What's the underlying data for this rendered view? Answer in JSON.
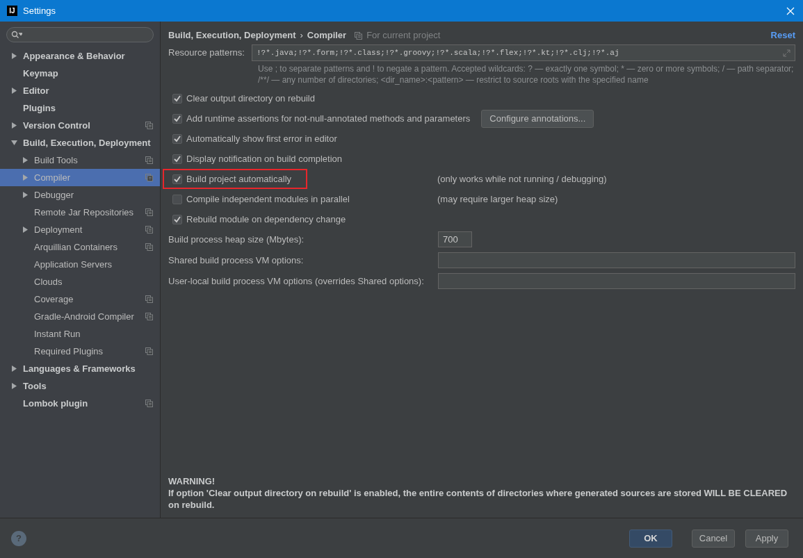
{
  "window": {
    "title": "Settings",
    "app_icon": "IJ"
  },
  "sidebar": {
    "items": [
      {
        "label": "Appearance & Behavior",
        "expanded": false,
        "has_children": true,
        "project_scope": false,
        "selected": false
      },
      {
        "label": "Keymap",
        "has_children": false,
        "project_scope": false,
        "selected": false
      },
      {
        "label": "Editor",
        "expanded": false,
        "has_children": true,
        "project_scope": false,
        "selected": false
      },
      {
        "label": "Plugins",
        "has_children": false,
        "project_scope": false,
        "selected": false
      },
      {
        "label": "Version Control",
        "expanded": false,
        "has_children": true,
        "project_scope": true,
        "selected": false
      },
      {
        "label": "Build, Execution, Deployment",
        "expanded": true,
        "has_children": true,
        "project_scope": false,
        "selected": false,
        "children": [
          {
            "label": "Build Tools",
            "expanded": false,
            "has_children": true,
            "project_scope": true,
            "selected": false
          },
          {
            "label": "Compiler",
            "expanded": false,
            "has_children": true,
            "project_scope": true,
            "selected": true
          },
          {
            "label": "Debugger",
            "expanded": false,
            "has_children": true,
            "project_scope": false,
            "selected": false
          },
          {
            "label": "Remote Jar Repositories",
            "has_children": false,
            "project_scope": true,
            "selected": false
          },
          {
            "label": "Deployment",
            "expanded": false,
            "has_children": true,
            "project_scope": true,
            "selected": false
          },
          {
            "label": "Arquillian Containers",
            "has_children": false,
            "project_scope": true,
            "selected": false
          },
          {
            "label": "Application Servers",
            "has_children": false,
            "project_scope": false,
            "selected": false
          },
          {
            "label": "Clouds",
            "has_children": false,
            "project_scope": false,
            "selected": false
          },
          {
            "label": "Coverage",
            "has_children": false,
            "project_scope": true,
            "selected": false
          },
          {
            "label": "Gradle-Android Compiler",
            "has_children": false,
            "project_scope": true,
            "selected": false
          },
          {
            "label": "Instant Run",
            "has_children": false,
            "project_scope": false,
            "selected": false
          },
          {
            "label": "Required Plugins",
            "has_children": false,
            "project_scope": true,
            "selected": false
          }
        ]
      },
      {
        "label": "Languages & Frameworks",
        "expanded": false,
        "has_children": true,
        "project_scope": false,
        "selected": false
      },
      {
        "label": "Tools",
        "expanded": false,
        "has_children": true,
        "project_scope": false,
        "selected": false
      },
      {
        "label": "Lombok plugin",
        "has_children": false,
        "project_scope": true,
        "selected": false
      }
    ]
  },
  "breadcrumb": {
    "parent": "Build, Execution, Deployment",
    "separator": "›",
    "current": "Compiler",
    "scope": "For current project"
  },
  "reset_link": "Reset",
  "resource_patterns": {
    "label": "Resource patterns:",
    "value": "!?*.java;!?*.form;!?*.class;!?*.groovy;!?*.scala;!?*.flex;!?*.kt;!?*.clj;!?*.aj",
    "hint": [
      "Use ; to separate patterns and ! to negate a pattern. Accepted wildcards: ? — exactly one symbol; * — zero or more symbols; / — path separator;",
      "/**/ — any number of directories;  <dir_name>:<pattern> — restrict to source roots with the specified name"
    ]
  },
  "options": [
    {
      "label": "Clear output directory on rebuild",
      "checked": true,
      "highlighted": false
    },
    {
      "label": "Add runtime assertions for not-null-annotated methods and parameters",
      "checked": true,
      "highlighted": false,
      "button": "Configure annotations..."
    },
    {
      "label": "Automatically show first error in editor",
      "checked": true,
      "highlighted": false
    },
    {
      "label": "Display notification on build completion",
      "checked": true,
      "highlighted": false
    },
    {
      "label": "Build project automatically",
      "checked": true,
      "highlighted": true,
      "note": "(only works while not running / debugging)"
    },
    {
      "label": "Compile independent modules in parallel",
      "checked": false,
      "highlighted": false,
      "note": "(may require larger heap size)"
    },
    {
      "label": "Rebuild module on dependency change",
      "checked": true,
      "highlighted": false
    }
  ],
  "fields": [
    {
      "label": "Build process heap size (Mbytes):",
      "value": "700",
      "kind": "short"
    },
    {
      "label": "Shared build process VM options:",
      "kind": "wide"
    },
    {
      "label": "User-local build process VM options (overrides Shared options):",
      "kind": "wide"
    }
  ],
  "warning": {
    "title": "WARNING!",
    "text": "If option 'Clear output directory on rebuild' is enabled, the entire contents of directories where generated sources are stored WILL BE CLEARED on rebuild."
  },
  "buttons": [
    {
      "label": "OK",
      "primary": true
    },
    {
      "label": "Cancel",
      "primary": false
    },
    {
      "label": "Apply",
      "primary": false
    }
  ],
  "help": "?"
}
